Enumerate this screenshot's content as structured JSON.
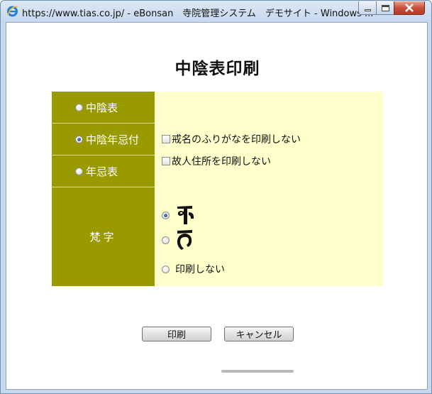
{
  "window": {
    "title": "https://www.tias.co.jp/ - eBonsan　寺院管理システム　デモサイト - Windows ...",
    "icon": "internet-explorer-icon"
  },
  "page": {
    "title": "中陰表印刷"
  },
  "report_type": {
    "options": [
      {
        "label": "中陰表",
        "selected": false
      },
      {
        "label": "中陰年忌付",
        "selected": true
      },
      {
        "label": "年忌表",
        "selected": false
      }
    ]
  },
  "checkboxes": [
    {
      "label": "戒名のふりがなを印刷しない",
      "checked": false
    },
    {
      "label": "故人住所を印刷しない",
      "checked": false
    }
  ],
  "bonji": {
    "label": "梵字",
    "options": [
      {
        "glyph": "siddham-a-glyph",
        "selected": true
      },
      {
        "glyph": "siddham-ka-glyph",
        "selected": false
      },
      {
        "label": "印刷しない",
        "selected": false
      }
    ]
  },
  "buttons": {
    "print": "印刷",
    "cancel": "キャンセル"
  },
  "colors": {
    "left_cell_bg": "#999900",
    "panel_bg": "#ffffcc"
  }
}
